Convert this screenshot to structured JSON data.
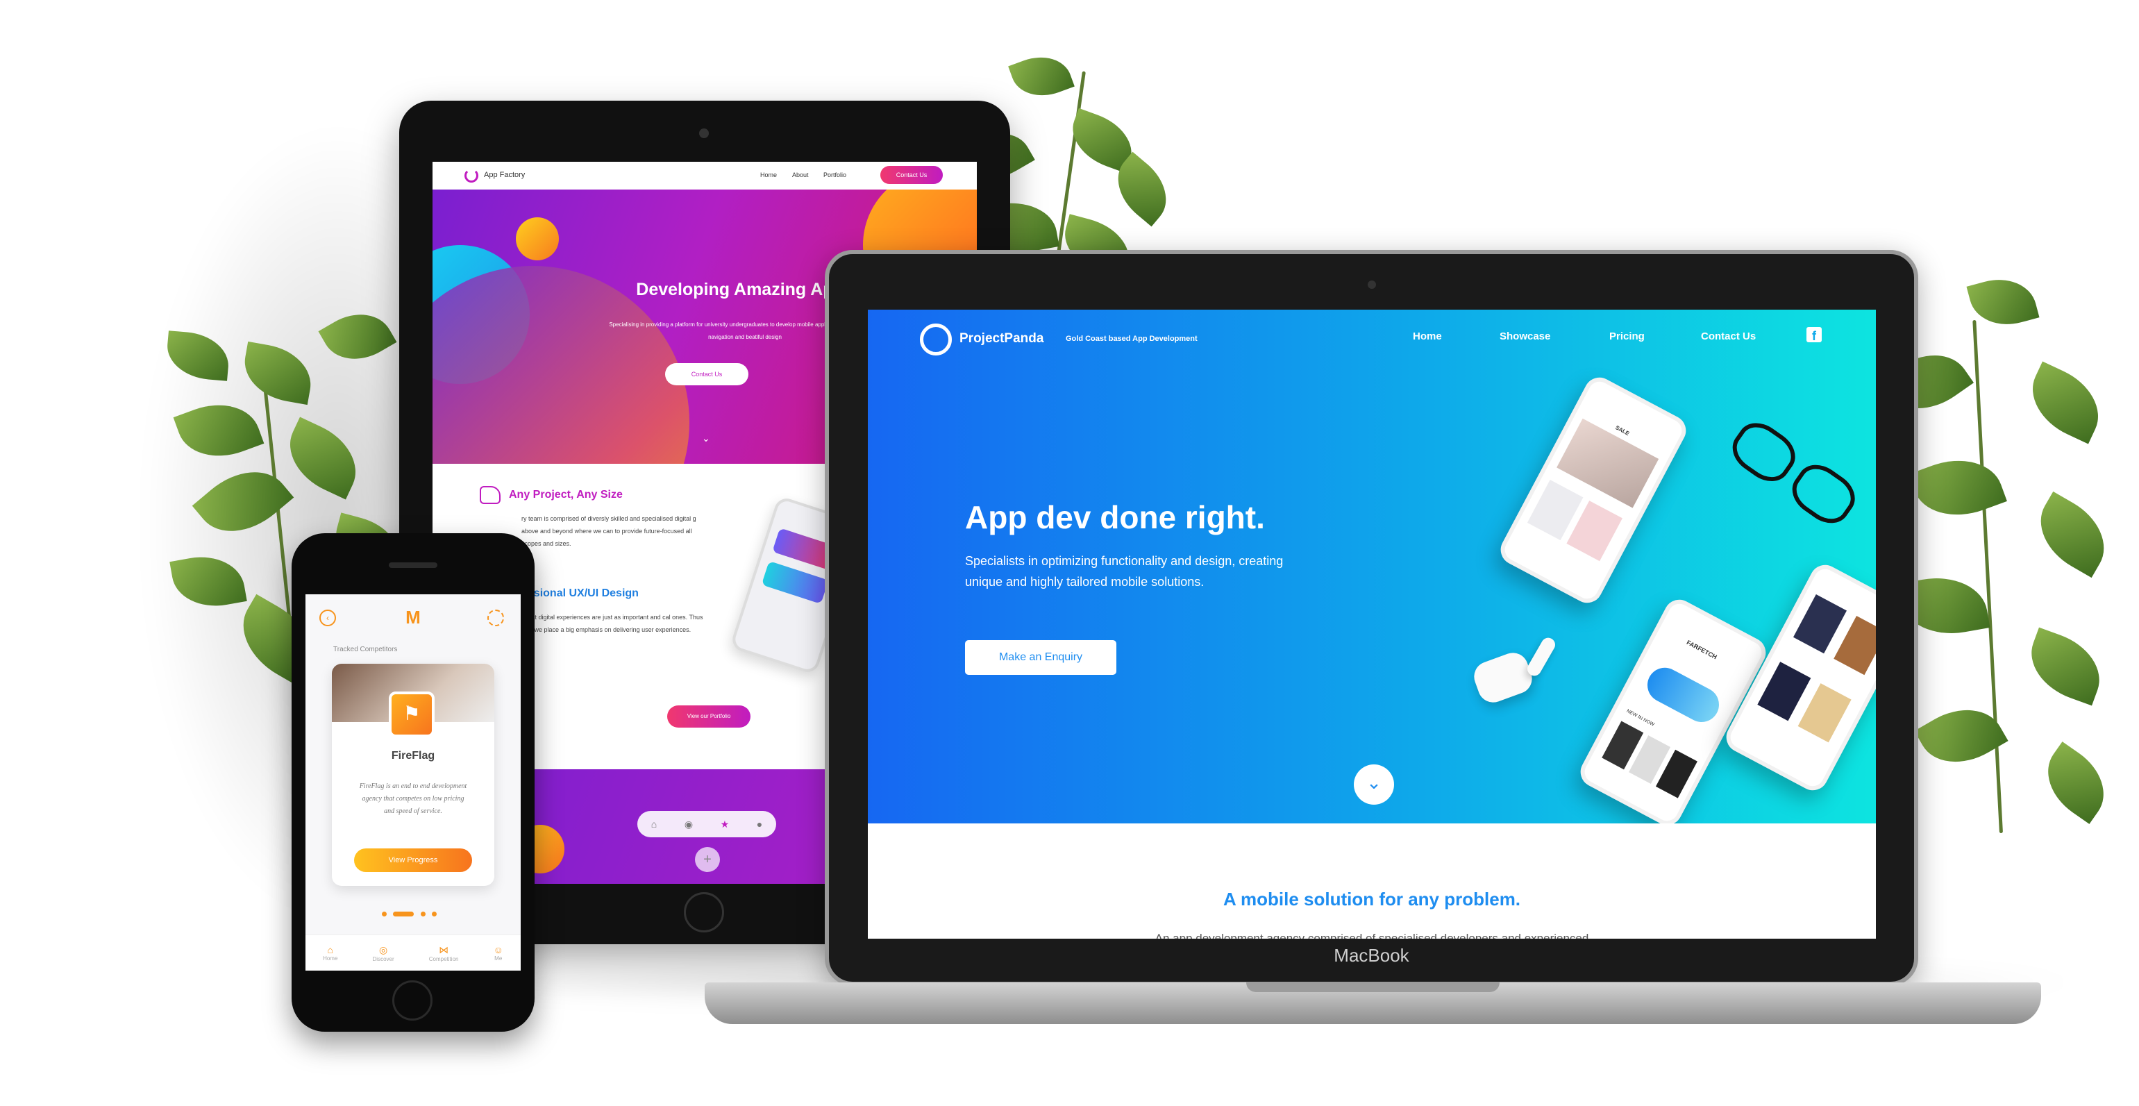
{
  "tablet": {
    "brand": "App Factory",
    "nav": [
      "Home",
      "About",
      "Portfolio"
    ],
    "contact_button": "Contact Us",
    "hero_title": "Developing Amazing Apps",
    "hero_text": "Specialising in providing a platform for university undergraduates to develop mobile applications with seamless navigation and beatiful design",
    "hero_button": "Contact Us",
    "section1_title": "Any Project, Any Size",
    "section1_text": "ry team is comprised of diversly skilled and specialised digital g above and beyond where we can to provide future-focused all scopes and sizes.",
    "section2_title": "essional UX/UI Design",
    "section2_text": "s that digital experiences are just as important and cal ones. Thus why we place a big emphasis on delivering user experiences.",
    "portfolio_button": "View our Portfolio"
  },
  "laptop": {
    "brand": "ProjectPanda",
    "tagline": "Gold Coast based App Development",
    "nav": [
      "Home",
      "Showcase",
      "Pricing",
      "Contact Us"
    ],
    "hero_title": "App dev done right.",
    "hero_text_1": "Specialists in optimizing functionality and design, creating",
    "hero_text_2": "unique and highly tailored mobile solutions.",
    "cta": "Make an Enquiry",
    "section_title": "A mobile solution for any problem.",
    "section_text": "An app development agency comprised of specialised developers and experienced",
    "bezel_label": "MacBook",
    "mock_phone_labels": [
      "SALE",
      "FARFETCH",
      "NEW IN NOW"
    ]
  },
  "phone": {
    "section_label": "Tracked Competitors",
    "card_title": "FireFlag",
    "card_text": "FireFlag is an end to end development agency that competes on low pricing and speed of service.",
    "card_button": "View Progress",
    "tabs": [
      "Home",
      "Discover",
      "Competition",
      "Me"
    ]
  },
  "colors": {
    "laptop_accent": "#1e8df0",
    "tablet_magenta": "#c01cc0",
    "tablet_pink": "#f0386f",
    "phone_orange": "#f7941d"
  }
}
